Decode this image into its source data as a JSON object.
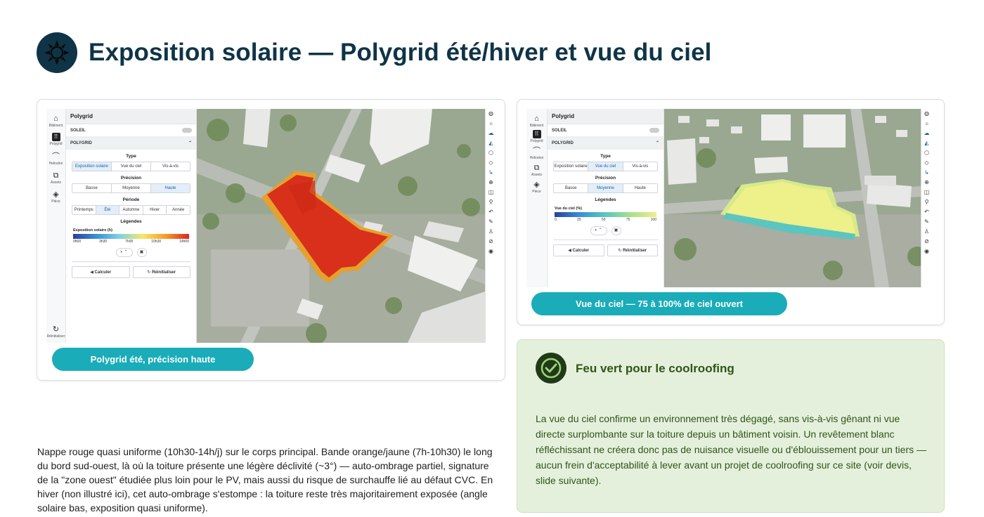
{
  "page": {
    "title": "Exposition solaire — Polygrid été/hiver et vue du ciel",
    "title_icon": "sun-icon"
  },
  "left_card": {
    "caption": "Polygrid été, précision haute",
    "app": {
      "rail": [
        {
          "icon": "home-icon",
          "label": "Bâtiment"
        },
        {
          "icon": "grid-icon",
          "label": "Polygrid"
        },
        {
          "icon": "rainbow-icon",
          "label": "Heliodon"
        },
        {
          "icon": "copy-icon",
          "label": "Assets"
        },
        {
          "icon": "layers-icon",
          "label": "Pièce"
        }
      ],
      "rail_bottom": {
        "icon": "reset-icon",
        "label": "Réinitialiser"
      },
      "panel_title": "Polygrid",
      "row_soleil": "SOLEIL",
      "row_polygrid": "POLYGRID",
      "type_label": "Type",
      "type_options": [
        "Exposition solaire",
        "Vue du ciel",
        "Vis-à-vis"
      ],
      "precision_label": "Précision",
      "precision_options": [
        "Basse",
        "Moyenne",
        "Haute"
      ],
      "periode_label": "Période",
      "periode_options": [
        "Printemps",
        "Été",
        "Automne",
        "Hiver",
        "Année"
      ],
      "legendes_label": "Légendes",
      "legend_title": "Exposition solaire (h)",
      "legend_ticks": [
        "0h00",
        "3h30",
        "7h00",
        "10h30",
        "14h00"
      ],
      "calc_label": "Calculer",
      "reset_label": "Réinitialiser"
    }
  },
  "right_card": {
    "caption": "Vue du ciel — 75 à 100% de ciel ouvert",
    "app": {
      "rail": [
        {
          "icon": "home-icon",
          "label": "Bâtiment"
        },
        {
          "icon": "grid-icon",
          "label": "Polygrid"
        },
        {
          "icon": "rainbow-icon",
          "label": "Heliodon"
        },
        {
          "icon": "copy-icon",
          "label": "Assets"
        },
        {
          "icon": "layers-icon",
          "label": "Pièce"
        }
      ],
      "panel_title": "Polygrid",
      "row_soleil": "SOLEIL",
      "row_polygrid": "POLYGRID",
      "type_label": "Type",
      "type_options": [
        "Exposition solaire",
        "Vue du ciel",
        "Vis-à-vis"
      ],
      "precision_label": "Précision",
      "precision_options": [
        "Basse",
        "Moyenne",
        "Haute"
      ],
      "legendes_label": "Légendes",
      "legend_title": "Vue du ciel (%)",
      "legend_ticks": [
        "0",
        "25",
        "50",
        "75",
        "100"
      ],
      "calc_label": "Calculer",
      "reset_label": "Réinitialiser"
    }
  },
  "green_card": {
    "title": "Feu vert pour le coolroofing",
    "body": "La vue du ciel confirme un environnement très dégagé, sans vis-à-vis gênant ni vue directe surplombante sur la toiture depuis un bâtiment voisin. Un revêtement blanc réfléchissant ne créera donc pas de nuisance visuelle ou d'éblouissement pour un tiers — aucun frein d'acceptabilité à lever avant un projet de coolroofing sur ce site (voir devis, slide suivante)."
  },
  "left_text": "Nappe rouge quasi uniforme (10h30-14h/j) sur le corps principal. Bande orange/jaune (7h-10h30) le long du bord sud-ouest, là où la toiture présente une légère déclivité (~3°) — auto-ombrage partiel, signature de la \"zone ouest\" étudiée plus loin pour le PV, mais aussi du risque de surchauffe lié au défaut CVC. En hiver (non illustré ici), cet auto-ombrage s'estompe : la toiture reste très majoritairement exposée (angle solaire bas, exposition quasi uniforme).",
  "colors": {
    "title": "#0f3447",
    "accent_pill": "#1aacb8",
    "green_card_bg": "#e4f0dc",
    "green_text": "#2f5518"
  }
}
